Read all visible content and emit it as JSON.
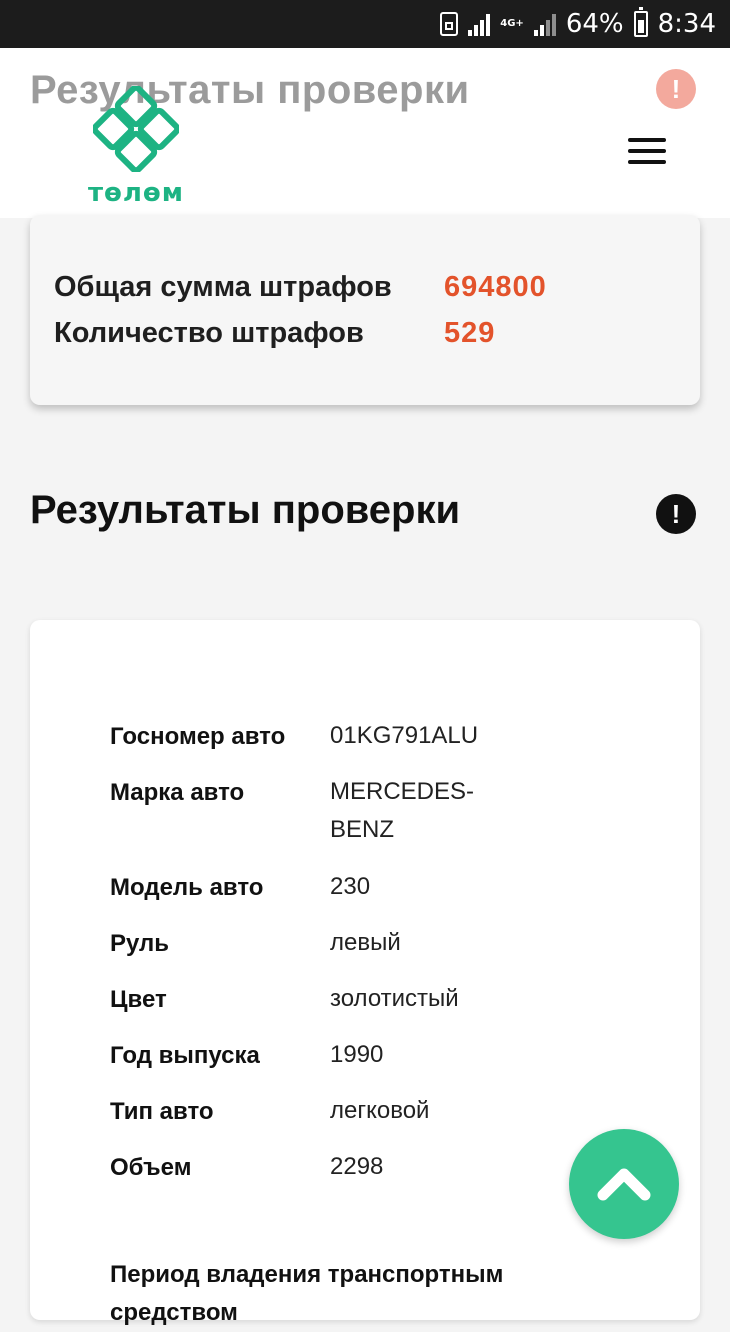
{
  "status_bar": {
    "network": "4G+",
    "battery": "64%",
    "time": "8:34"
  },
  "header": {
    "ghost_title": "Результаты проверки",
    "logo_text": "төлөм",
    "alert_symbol": "!"
  },
  "summary": {
    "total_label": "Общая сумма штрафов",
    "total_value": "694800",
    "count_label": "Количество штрафов",
    "count_value": "529"
  },
  "section": {
    "title": "Результаты проверки",
    "alert_symbol": "!"
  },
  "details": {
    "rows": [
      {
        "label": "Госномер авто",
        "value": "01KG791ALU"
      },
      {
        "label": "Марка авто",
        "value": "MERCEDES-BENZ"
      },
      {
        "label": "Модель авто",
        "value": "230"
      },
      {
        "label": "Руль",
        "value": "левый"
      },
      {
        "label": "Цвет",
        "value": "золотистый"
      },
      {
        "label": "Год выпуска",
        "value": "1990"
      },
      {
        "label": "Тип авто",
        "value": "легковой"
      },
      {
        "label": "Объем",
        "value": "2298"
      }
    ],
    "period_label": "Период владения транспортным средством"
  },
  "icons": {
    "menu": "hamburger-icon",
    "scroll_top": "chevron-up-icon",
    "alert": "exclamation-icon"
  },
  "colors": {
    "accent_green": "#1db383",
    "fab_green": "#35c58f",
    "value_orange": "#e3532b",
    "ghost_alert": "#f3a99d"
  }
}
